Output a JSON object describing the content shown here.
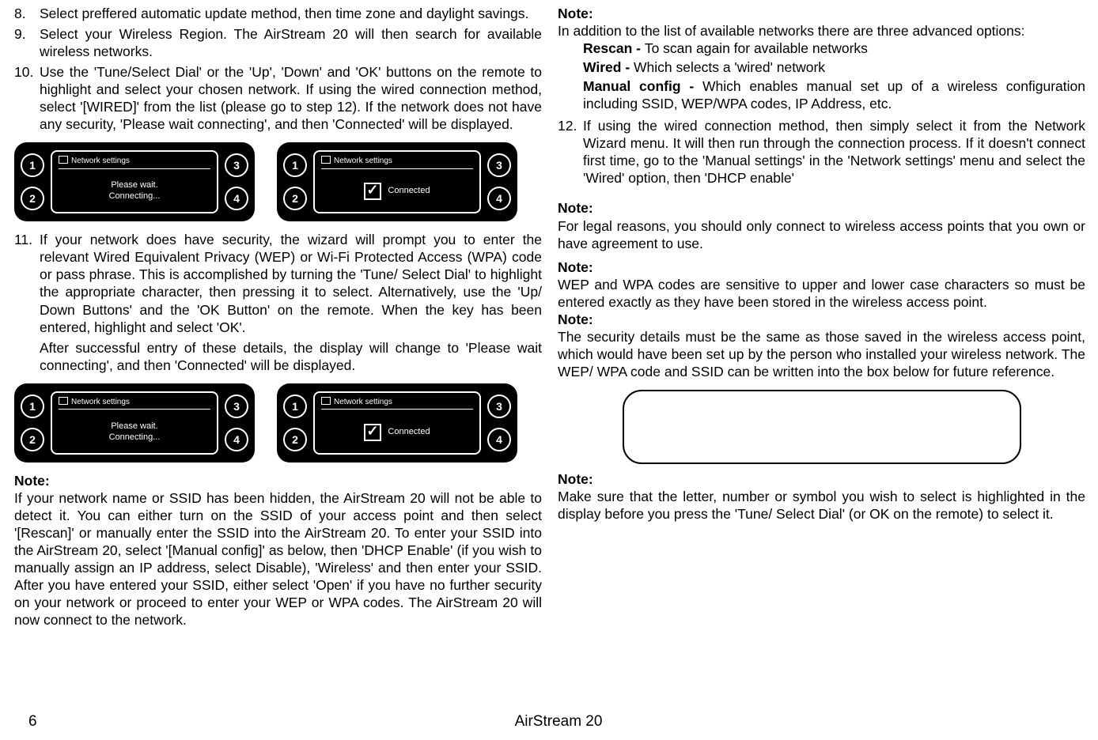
{
  "left": {
    "items": [
      {
        "num": "8.",
        "text": "Select preffered automatic update method, then time zone and daylight savings."
      },
      {
        "num": "9.",
        "text": "Select your Wireless Region.  The AirStream 20 will then search for available wireless networks."
      },
      {
        "num": "10.",
        "text": "Use the 'Tune/Select Dial' or the 'Up', 'Down' and 'OK' buttons on the remote to highlight and select your chosen network. If using the wired connection method, select '[WIRED]' from the list (please go to step 12).  If the network does not have any security, 'Please wait connecting', and then 'Connected' will be displayed."
      },
      {
        "num": "11.",
        "text": "If your network does have security, the wizard will prompt you to enter the relevant Wired Equivalent Privacy (WEP) or Wi-Fi Protected Access (WPA) code or pass phrase.  This is accomplished by turning the 'Tune/ Select Dial' to highlight the appropriate character, then pressing it to select.  Alternatively, use the 'Up/ Down Buttons' and the 'OK Button' on the remote.  When the key has been entered, highlight and select 'OK'."
      }
    ],
    "item11_extra": "After successful entry of these details, the display will change to 'Please wait connecting', and then 'Connected' will be displayed.",
    "note_label": "Note:",
    "note1": "If your network name or SSID has been hidden, the AirStream 20 will not be able to detect it. You can either turn on the SSID of your access point and then select '[Rescan]' or manually enter the SSID into the AirStream 20.   To enter your SSID into the AirStream 20, select '[Manual config]' as below, then 'DHCP Enable' (if you wish to manually assign an IP address, select Disable), 'Wireless' and then enter your SSID.  After you have entered your SSID, either select 'Open' if you have no further security on your network or proceed to enter your WEP or WPA codes. The AirStream 20 will now connect to the network."
  },
  "right": {
    "note_label": "Note:",
    "intro": "In addition to the list of available networks there are three advanced options:",
    "opts": [
      {
        "b": "Rescan - ",
        "t": "To scan again for available networks"
      },
      {
        "b": "Wired - ",
        "t": "Which selects a 'wired' network"
      },
      {
        "b": "Manual config - ",
        "t": "Which enables manual set up of a wireless configuration including SSID, WEP/WPA codes, IP Address, etc."
      }
    ],
    "item12_num": "12.",
    "item12": "If using the wired connection method, then simply select it from the Network Wizard menu.  It will then run through the connection process.  If it doesn't connect first time, go to the 'Manual settings' in the 'Network settings' menu and select the 'Wired' option, then 'DHCP enable'",
    "note2": "For legal reasons, you should only connect to wireless access points that you own or have agreement to use.",
    "note3": "WEP and WPA codes are sensitive to upper and lower case characters so must be entered exactly as they have been stored in the wireless access point.",
    "note4": "The security details must be the same as those saved in the wireless access point, which would have been set up by the person who installed your wireless network. The WEP/ WPA code and SSID can be written into the box below for future reference.",
    "note5": "Make sure that the letter, number or symbol you wish to select is highlighted in the display before you press the 'Tune/ Select Dial' (or OK on the remote) to select it."
  },
  "device": {
    "title": "Network settings",
    "wait_l1": "Please wait.",
    "wait_l2": "Connecting...",
    "connected": "Connected",
    "b1": "1",
    "b2": "2",
    "b3": "3",
    "b4": "4"
  },
  "footer": {
    "page": "6",
    "product": "AirStream 20"
  }
}
